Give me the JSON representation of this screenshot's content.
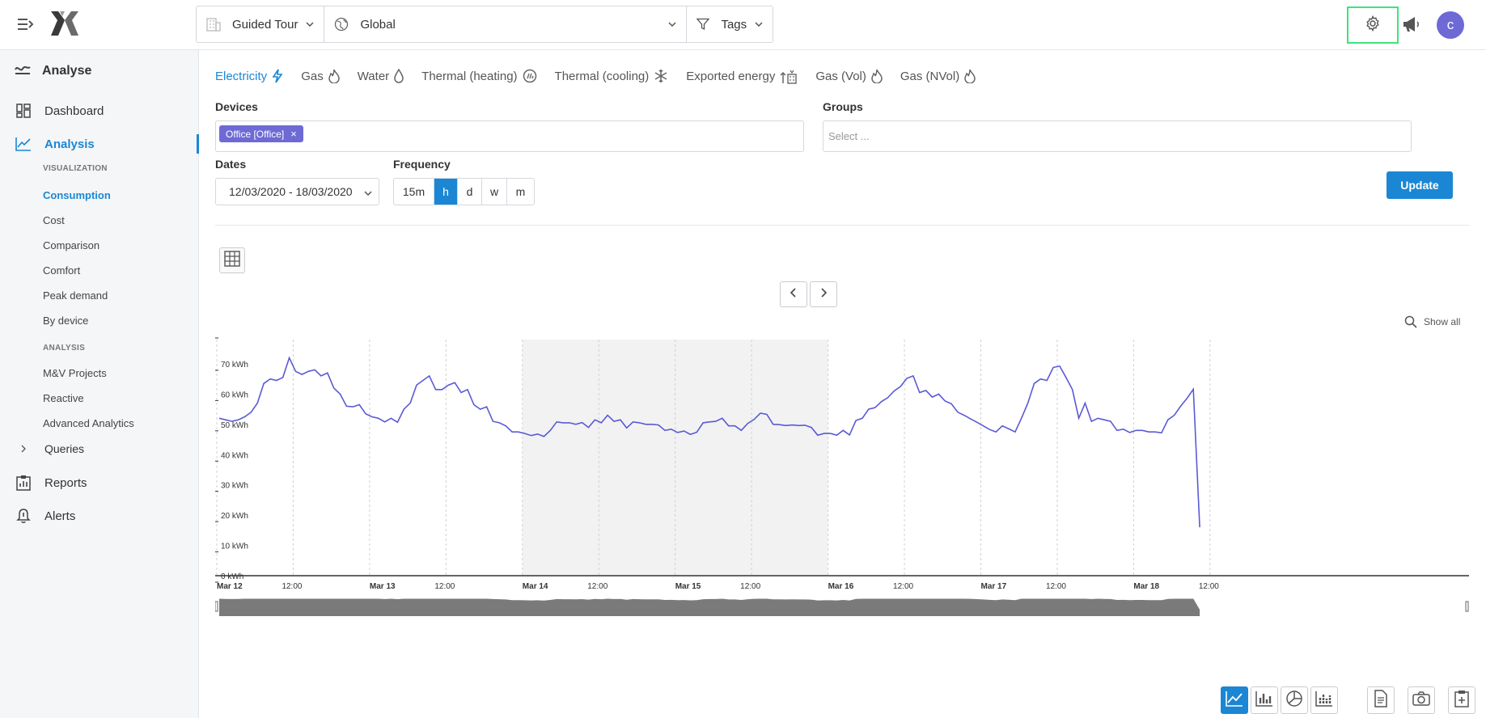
{
  "header": {
    "site_label": "Guided Tour",
    "scope_label": "Global",
    "tags_label": "Tags",
    "avatar_initial": "c",
    "highlight_color": "#3ee37e"
  },
  "sidebar": {
    "section_title": "Analyse",
    "dashboard": "Dashboard",
    "analysis": "Analysis",
    "visualization_header": "VISUALIZATION",
    "visualization_items": [
      "Consumption",
      "Cost",
      "Comparison",
      "Comfort",
      "Peak demand",
      "By device"
    ],
    "analysis_header": "ANALYSIS",
    "analysis_items": [
      "M&V Projects",
      "Reactive",
      "Advanced Analytics"
    ],
    "queries": "Queries",
    "reports": "Reports",
    "alerts": "Alerts"
  },
  "energy_tabs": [
    {
      "label": "Electricity",
      "icon": "bolt-icon"
    },
    {
      "label": "Gas",
      "icon": "flame-icon"
    },
    {
      "label": "Water",
      "icon": "drop-icon"
    },
    {
      "label": "Thermal (heating)",
      "icon": "heating-icon"
    },
    {
      "label": "Thermal (cooling)",
      "icon": "snowflake-icon"
    },
    {
      "label": "Exported energy",
      "icon": "export-icon"
    },
    {
      "label": "Gas (Vol)",
      "icon": "flame-icon"
    },
    {
      "label": "Gas (NVol)",
      "icon": "flame-icon"
    }
  ],
  "filters": {
    "devices_label": "Devices",
    "device_chip": "Office [Office]",
    "groups_label": "Groups",
    "groups_placeholder": "Select ...",
    "dates_label": "Dates",
    "date_range": "12/03/2020 - 18/03/2020",
    "frequency_label": "Frequency",
    "frequency_options": [
      "15m",
      "h",
      "d",
      "w",
      "m"
    ],
    "frequency_selected": "h",
    "update_label": "Update"
  },
  "chart_controls": {
    "show_all": "Show all"
  },
  "chart_data": {
    "type": "line",
    "unit": "kWh",
    "y_ticks": [
      "0 kWh",
      "10 kWh",
      "20 kWh",
      "30 kWh",
      "40 kWh",
      "50 kWh",
      "60 kWh",
      "70 kWh"
    ],
    "ylim": [
      0,
      78
    ],
    "x_ticks": [
      "Mar 12",
      "12:00",
      "Mar 13",
      "12:00",
      "Mar 14",
      "12:00",
      "Mar 15",
      "12:00",
      "Mar 16",
      "12:00",
      "Mar 17",
      "12:00",
      "Mar 18",
      "12:00"
    ],
    "x_tick_bold": [
      true,
      false,
      true,
      false,
      true,
      false,
      true,
      false,
      true,
      false,
      true,
      false,
      true,
      false
    ],
    "weekend_shading": [
      "Mar 14",
      "Mar 16"
    ],
    "line_color": "#5a5ad6",
    "series": [
      {
        "values": [
          52,
          51.5,
          51,
          51.5,
          52.5,
          54,
          57,
          63.5,
          65,
          64.5,
          65.5,
          72,
          67.5,
          66.5,
          67.5,
          68,
          66,
          67,
          62,
          60,
          56,
          55.8,
          56.5,
          53.5,
          52.5,
          52,
          50.8,
          52,
          50.7,
          55,
          57,
          63,
          64.5,
          66,
          61.5,
          61.5,
          63,
          63.8,
          60.5,
          61.5,
          56.5,
          55,
          55.8,
          51,
          50.5,
          49.5,
          47.5,
          47.5,
          47,
          46.3,
          46.8,
          46,
          48,
          50.8,
          50.5,
          50.5,
          50,
          50.6,
          49,
          51.5,
          50.5,
          53,
          51,
          51.5,
          48.8,
          50.8,
          50.5,
          50,
          50,
          49.8,
          48,
          48.4,
          47.3,
          47.8,
          46.7,
          47.4,
          50.5,
          50.8,
          51,
          52,
          49.5,
          49.5,
          48,
          50.3,
          51.6,
          53.7,
          53.3,
          50,
          49.9,
          49.6,
          49.8,
          49.6,
          49.7,
          49,
          46.4,
          47,
          47,
          46.4,
          48,
          46.5,
          51.3,
          52,
          55,
          55.5,
          57.5,
          58.8,
          61,
          62.5,
          65.2,
          66,
          60.5,
          61.2,
          59,
          60,
          57.7,
          56.8,
          54,
          53,
          51.8,
          50.7,
          49.5,
          48.3,
          47.5,
          49.5,
          48.5,
          47.5,
          52,
          57,
          63.5,
          65,
          64.5,
          68.8,
          69.2,
          65.5,
          61.5,
          52,
          57,
          51,
          52,
          51.5,
          51,
          48,
          48.4,
          47.3,
          48,
          48,
          47.5,
          47.5,
          47.2,
          51.5,
          53,
          56,
          58.6,
          61.6,
          16
        ]
      }
    ]
  }
}
